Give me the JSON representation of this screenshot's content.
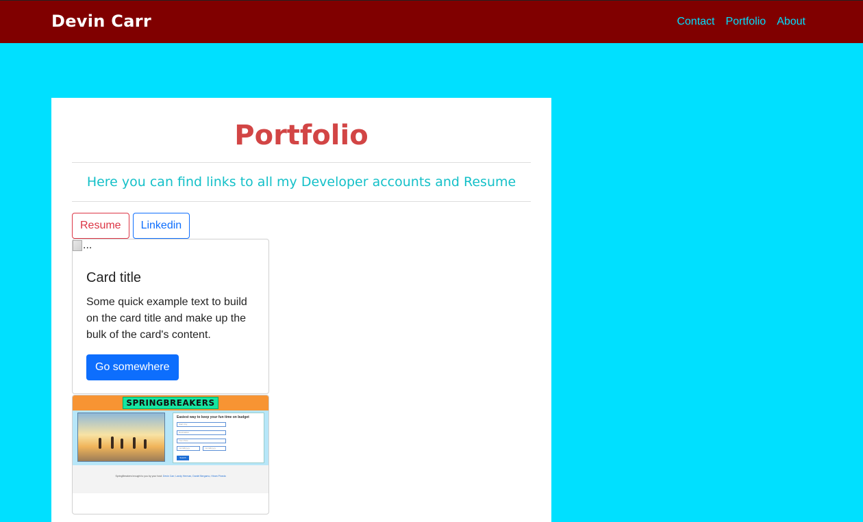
{
  "navbar": {
    "brand": "Devin Carr",
    "links": [
      "Contact",
      "Portfolio",
      "About"
    ]
  },
  "main": {
    "title": "Portfolio",
    "subtitle": "Here you can find links to all my Developer accounts and Resume",
    "buttons": {
      "resume": "Resume",
      "linkedin": "Linkedin"
    },
    "card": {
      "image_alt": "...",
      "title": "Card title",
      "text": "Some quick example text to build on the card title and make up the bulk of the card's content.",
      "button": "Go somewhere"
    },
    "project_card": {
      "logo": "SPRINGBREAKERS",
      "form_title": "Easiest way to keep your fun time on budget",
      "field_placeholders": [
        "Start City",
        "Destination",
        "Your Price"
      ],
      "date_placeholders": [
        "mm/dd/yyyy",
        "mm/dd/yyyy"
      ],
      "search_label": "Search",
      "footer_prefix": "SpringBreakers brought to you by your host:",
      "footer_names": "Devin Carr, Landy Herman, Daniel Bergamo, Hiram Pineda"
    }
  },
  "colors": {
    "navbar_bg": "#800000",
    "page_bg": "#00e0ff",
    "nav_link": "#00e0ff",
    "title": "#d24545",
    "subtitle": "#14c0c8",
    "danger": "#dc3545",
    "primary": "#0d6efd"
  }
}
